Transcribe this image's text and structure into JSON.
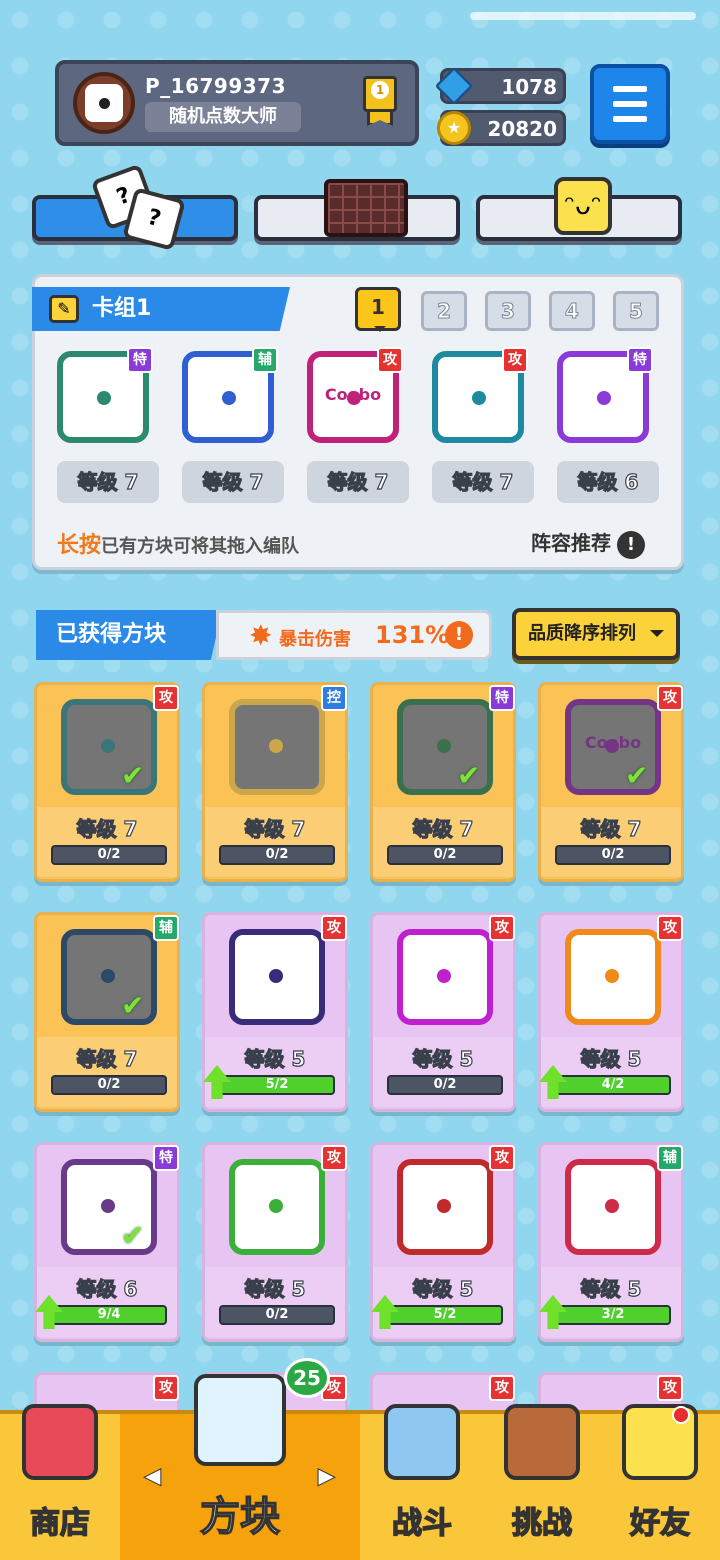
{
  "profile": {
    "name": "P_16799373",
    "title": "随机点数大师",
    "medal": "1"
  },
  "currency": {
    "gems": "1078",
    "coins": "20820"
  },
  "deck": {
    "title": "卡组1",
    "slots": [
      "1",
      "2",
      "3",
      "4",
      "5"
    ],
    "active_slot": "1",
    "cards": [
      {
        "type": "特",
        "level": "等级 7",
        "color": "#2b8a6e"
      },
      {
        "type": "辅",
        "level": "等级 7",
        "color": "#2f5fd0"
      },
      {
        "type": "攻",
        "level": "等级 7",
        "color": "#c0227a",
        "text": "Coobo"
      },
      {
        "type": "攻",
        "level": "等级 7",
        "color": "#1d8aa0"
      },
      {
        "type": "特",
        "level": "等级 6",
        "color": "#8a3ad9"
      }
    ],
    "hint_prefix": "长按",
    "hint_text": "已有方块可将其拖入编队",
    "recommend": "阵容推荐"
  },
  "owned": {
    "title": "已获得方块",
    "crit_label": "暴击伤害",
    "crit_value": "131%",
    "sort_label": "品质降序排列",
    "cards": [
      {
        "type": "攻",
        "level": "等级 7",
        "progress": "0/2",
        "style": "gold",
        "color": "#2b6f7a",
        "check": true
      },
      {
        "type": "控",
        "level": "等级 7",
        "progress": "0/2",
        "style": "gold",
        "color": "#c9a54a",
        "check": false
      },
      {
        "type": "特",
        "level": "等级 7",
        "progress": "0/2",
        "style": "gold",
        "color": "#2b6a4e",
        "check": true
      },
      {
        "type": "攻",
        "level": "等级 7",
        "progress": "0/2",
        "style": "gold",
        "color": "#6a2a8a",
        "check": true,
        "text": "Coobo"
      },
      {
        "type": "辅",
        "level": "等级 7",
        "progress": "0/2",
        "style": "gold",
        "color": "#1d3f6a",
        "check": true
      },
      {
        "type": "攻",
        "level": "等级 5",
        "progress": "5/2",
        "style": "lilac",
        "color": "#3a2a7a",
        "up": true
      },
      {
        "type": "攻",
        "level": "等级 5",
        "progress": "0/2",
        "style": "lilac",
        "color": "#c020d0"
      },
      {
        "type": "攻",
        "level": "等级 5",
        "progress": "4/2",
        "style": "lilac",
        "color": "#f08a1a",
        "up": true
      },
      {
        "type": "特",
        "level": "等级 6",
        "progress": "9/4",
        "style": "lilac",
        "color": "#6a3a8a",
        "up": true,
        "check": true
      },
      {
        "type": "攻",
        "level": "等级 5",
        "progress": "0/2",
        "style": "lilac",
        "color": "#3ab03a"
      },
      {
        "type": "攻",
        "level": "等级 5",
        "progress": "5/2",
        "style": "lilac",
        "color": "#c02a2a",
        "up": true
      },
      {
        "type": "辅",
        "level": "等级 5",
        "progress": "3/2",
        "style": "lilac",
        "color": "#d02a4a",
        "up": true
      }
    ],
    "partial_types": [
      "攻",
      "攻",
      "攻",
      "攻"
    ]
  },
  "nav": {
    "shop": "商店",
    "blocks": "方块",
    "battle": "战斗",
    "challenge": "挑战",
    "friends": "好友",
    "count": "25"
  },
  "colors": {
    "accent": "#2b8ae8",
    "gold": "#fbc73a",
    "attack": "#e53333",
    "special": "#8a3ad9",
    "support": "#26a86a",
    "control": "#2f7de0"
  }
}
